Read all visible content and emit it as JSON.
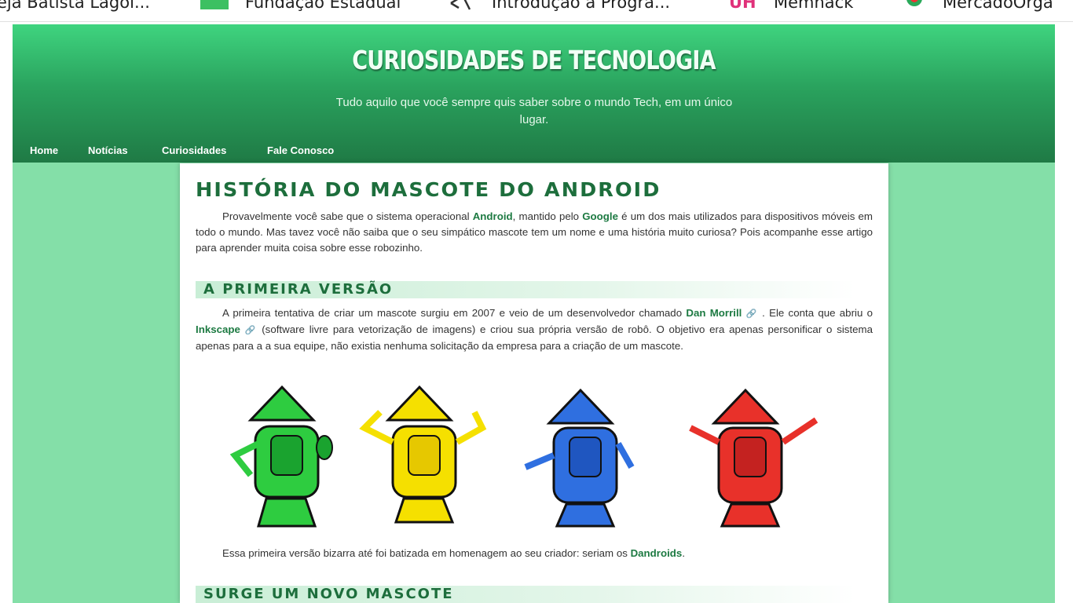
{
  "bookmarks": [
    {
      "label": "eja Batista Lagoi...",
      "icon": "none"
    },
    {
      "label": "Fundação Estadual",
      "icon": "green-square-icon"
    },
    {
      "label": "Introdução à Progra...",
      "icon": "code-icon"
    },
    {
      "label": "Memhack",
      "icon": "memhack-icon"
    },
    {
      "label": "MercadoOrga",
      "icon": "mercado-icon"
    }
  ],
  "site": {
    "title": "CURIOSIDADES DE TECNOLOGIA",
    "description": "Tudo aquilo que você sempre quis saber sobre o mundo Tech, em um único lugar."
  },
  "nav": [
    "Home",
    "Notícias",
    "Curiosidades",
    "Fale Conosco"
  ],
  "post": {
    "title": "HISTÓRIA DO MASCOTE DO ANDROID",
    "intro": {
      "t1": "Provavelmente você sabe que o sistema operacional ",
      "b1": "Android",
      "t2": ", mantido pelo ",
      "b2": "Google",
      "t3": " é um dos mais utilizados para dispositivos móveis em todo o mundo. Mas tavez você não saiba que o seu simpático mascote tem um nome e uma história muito curiosa? Pois acompanhe esse artigo para aprender muita coisa sobre esse robozinho."
    },
    "section1": "A PRIMEIRA VERSÃO",
    "p2": {
      "t1": "A primeira tentativa de criar um mascote surgiu em 2007 e veio de um desenvolvedor chamado ",
      "b1": "Dan Morrill",
      "t2": " . Ele conta que abriu o ",
      "b2": "Inkscape",
      "t3": "  (software livre para vetorização de imagens) e criou sua própria versão de robô. O objetivo era apenas personificar o sistema apenas para a a sua equipe, não existia nenhuma solicitação da empresa para a criação de um mascote."
    },
    "p3": {
      "t1": "Essa primeira versão bizarra até foi batizada em homenagem ao seu criador: seriam os ",
      "b1": "Dandroids",
      "t2": "."
    },
    "section2": "SURGE UM NOVO MASCOTE"
  },
  "colors": {
    "header_top": "#3fd47f",
    "header_bottom": "#1f7a45",
    "site_bg": "#84dfa8",
    "accent_text": "#1d6e3c",
    "robots": [
      "#2ecc40",
      "#f5e000",
      "#2f6fe0",
      "#e8312a"
    ]
  }
}
